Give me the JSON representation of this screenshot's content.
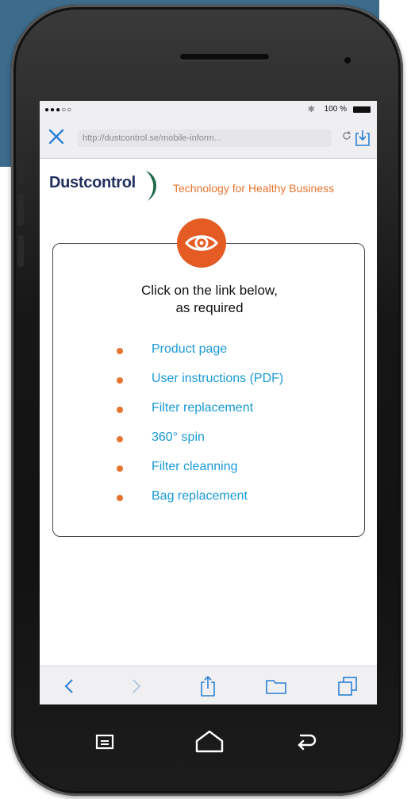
{
  "status_bar": {
    "signal": "●●●○○",
    "battery": "100 %"
  },
  "browser": {
    "url": "http://dustcontrol.se/mobile-inform...",
    "icons": [
      "close-icon",
      "reload-icon",
      "download-icon"
    ]
  },
  "header": {
    "logo_text": "Dustcontrol",
    "tagline": "Technology for Healthy Business"
  },
  "card": {
    "title_line1": "Click on the link below,",
    "title_line2": "as required",
    "links": [
      {
        "label": "Product page"
      },
      {
        "label": "User instructions (PDF)"
      },
      {
        "label": "Filter replacement"
      },
      {
        "label": "360° spin"
      },
      {
        "label": "Filter cleanning"
      },
      {
        "label": "Bag replacement"
      }
    ]
  },
  "toolbar": {
    "icons": [
      "back-icon",
      "forward-icon",
      "share-icon",
      "bookmarks-icon",
      "tabs-icon"
    ]
  },
  "nav_bar": {
    "icons": [
      "menu-icon",
      "home-icon",
      "back-arrow-icon"
    ]
  },
  "colors": {
    "accent_orange": "#e7742f",
    "eye_badge": "#e45c24",
    "link_blue": "#1a9ad6",
    "ios_blue": "#2a7fd6",
    "logo_navy": "#22305e"
  }
}
